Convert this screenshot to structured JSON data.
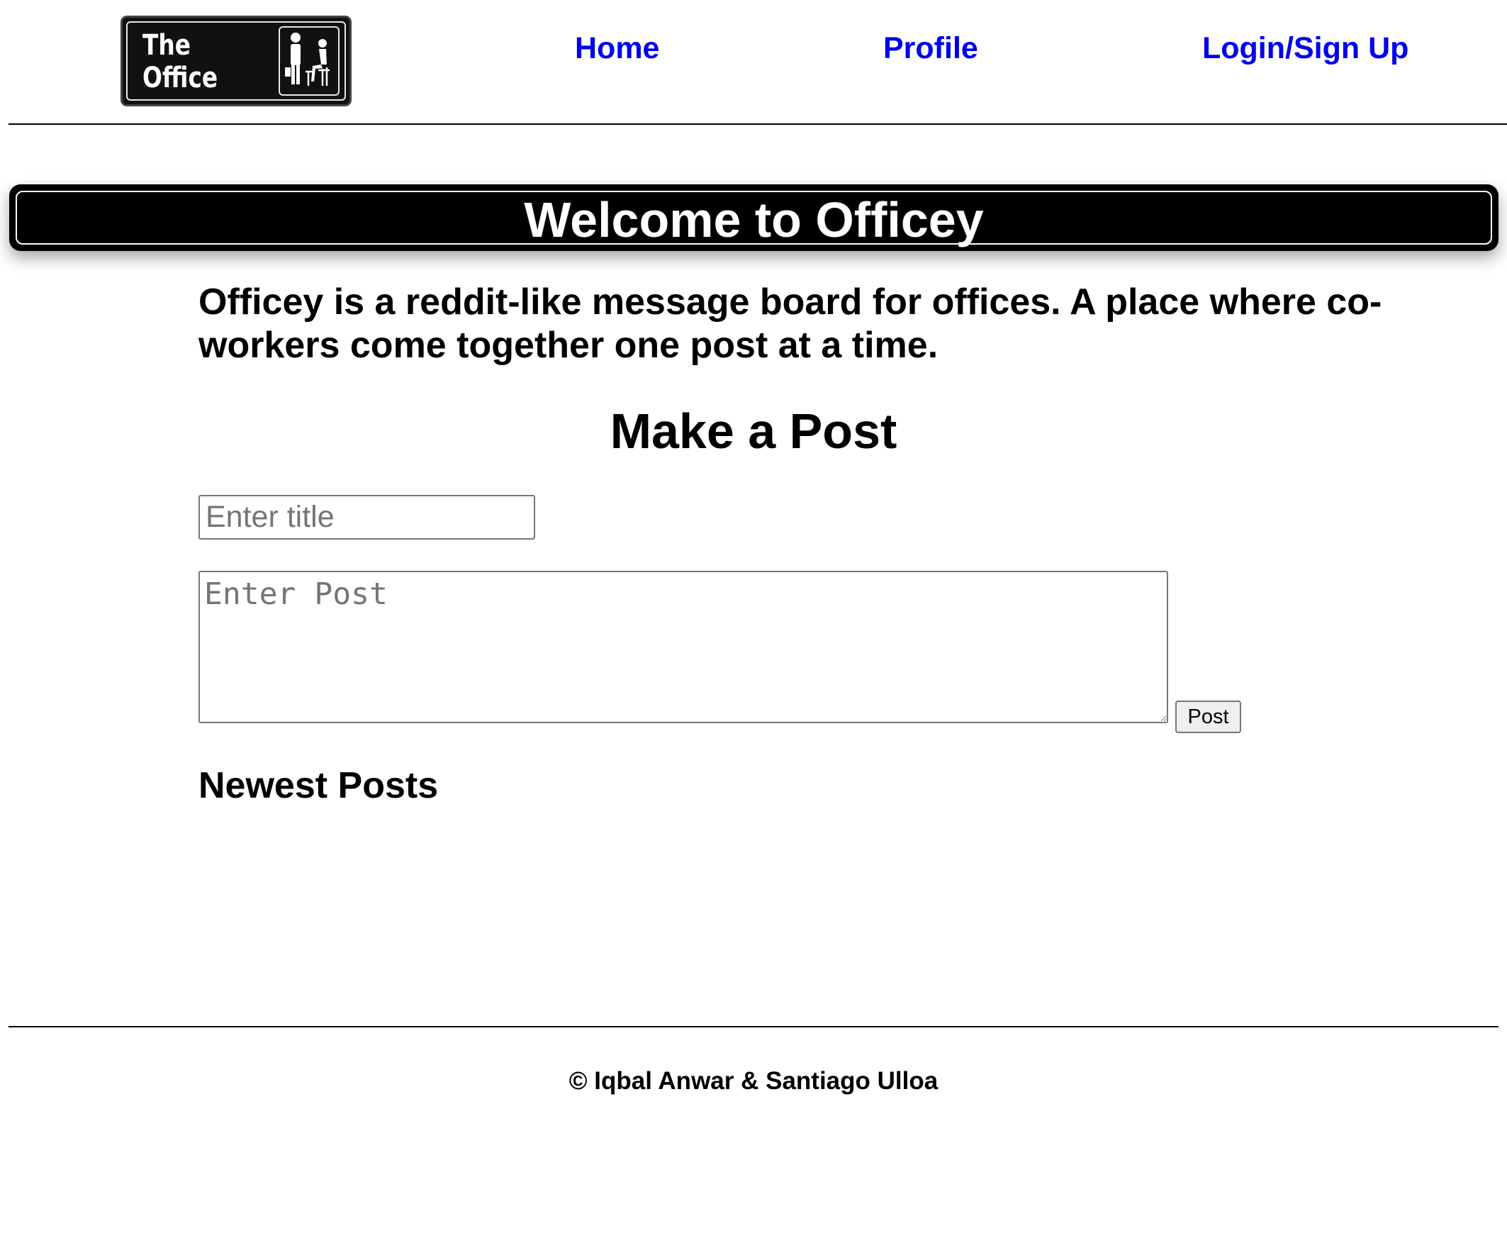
{
  "header": {
    "logo": {
      "text": "The\nOffice",
      "icon": "office-workers-sign-icon"
    },
    "nav": [
      {
        "label": "Home"
      },
      {
        "label": "Profile"
      },
      {
        "label": "Login/Sign Up"
      }
    ]
  },
  "banner": {
    "title": "Welcome to Officey"
  },
  "main": {
    "intro": "Officey is a reddit-like message board for offices. A place where co-workers come together one post at a time.",
    "make_post_heading": "Make a Post",
    "title_input": {
      "placeholder": "Enter title",
      "value": ""
    },
    "post_textarea": {
      "placeholder": "Enter Post",
      "value": ""
    },
    "post_button_label": "Post",
    "newest_posts_heading": "Newest Posts",
    "posts": []
  },
  "footer": {
    "copyright": "© Iqbal Anwar & Santiago Ulloa"
  },
  "colors": {
    "link": "#0000ee",
    "banner_background": "#000000",
    "banner_text": "#ffffff",
    "logo_background": "#111111"
  }
}
